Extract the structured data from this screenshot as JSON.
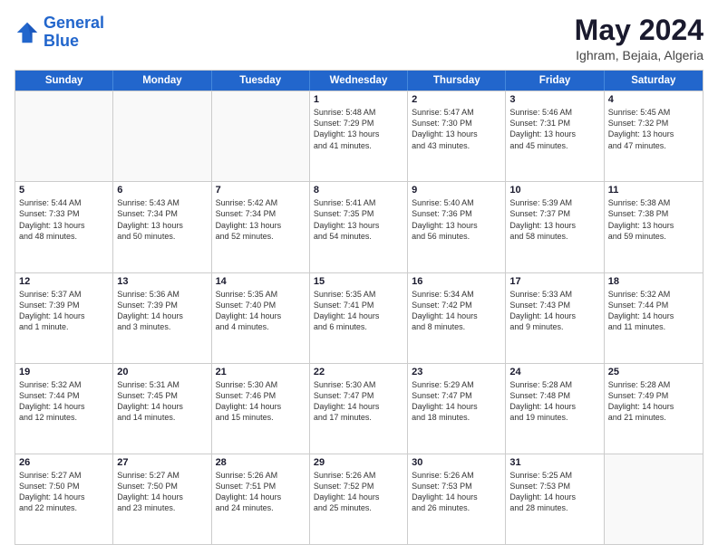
{
  "logo": {
    "line1": "General",
    "line2": "Blue"
  },
  "title": "May 2024",
  "location": "Ighram, Bejaia, Algeria",
  "days_of_week": [
    "Sunday",
    "Monday",
    "Tuesday",
    "Wednesday",
    "Thursday",
    "Friday",
    "Saturday"
  ],
  "weeks": [
    [
      {
        "day": "",
        "info": ""
      },
      {
        "day": "",
        "info": ""
      },
      {
        "day": "",
        "info": ""
      },
      {
        "day": "1",
        "info": "Sunrise: 5:48 AM\nSunset: 7:29 PM\nDaylight: 13 hours\nand 41 minutes."
      },
      {
        "day": "2",
        "info": "Sunrise: 5:47 AM\nSunset: 7:30 PM\nDaylight: 13 hours\nand 43 minutes."
      },
      {
        "day": "3",
        "info": "Sunrise: 5:46 AM\nSunset: 7:31 PM\nDaylight: 13 hours\nand 45 minutes."
      },
      {
        "day": "4",
        "info": "Sunrise: 5:45 AM\nSunset: 7:32 PM\nDaylight: 13 hours\nand 47 minutes."
      }
    ],
    [
      {
        "day": "5",
        "info": "Sunrise: 5:44 AM\nSunset: 7:33 PM\nDaylight: 13 hours\nand 48 minutes."
      },
      {
        "day": "6",
        "info": "Sunrise: 5:43 AM\nSunset: 7:34 PM\nDaylight: 13 hours\nand 50 minutes."
      },
      {
        "day": "7",
        "info": "Sunrise: 5:42 AM\nSunset: 7:34 PM\nDaylight: 13 hours\nand 52 minutes."
      },
      {
        "day": "8",
        "info": "Sunrise: 5:41 AM\nSunset: 7:35 PM\nDaylight: 13 hours\nand 54 minutes."
      },
      {
        "day": "9",
        "info": "Sunrise: 5:40 AM\nSunset: 7:36 PM\nDaylight: 13 hours\nand 56 minutes."
      },
      {
        "day": "10",
        "info": "Sunrise: 5:39 AM\nSunset: 7:37 PM\nDaylight: 13 hours\nand 58 minutes."
      },
      {
        "day": "11",
        "info": "Sunrise: 5:38 AM\nSunset: 7:38 PM\nDaylight: 13 hours\nand 59 minutes."
      }
    ],
    [
      {
        "day": "12",
        "info": "Sunrise: 5:37 AM\nSunset: 7:39 PM\nDaylight: 14 hours\nand 1 minute."
      },
      {
        "day": "13",
        "info": "Sunrise: 5:36 AM\nSunset: 7:39 PM\nDaylight: 14 hours\nand 3 minutes."
      },
      {
        "day": "14",
        "info": "Sunrise: 5:35 AM\nSunset: 7:40 PM\nDaylight: 14 hours\nand 4 minutes."
      },
      {
        "day": "15",
        "info": "Sunrise: 5:35 AM\nSunset: 7:41 PM\nDaylight: 14 hours\nand 6 minutes."
      },
      {
        "day": "16",
        "info": "Sunrise: 5:34 AM\nSunset: 7:42 PM\nDaylight: 14 hours\nand 8 minutes."
      },
      {
        "day": "17",
        "info": "Sunrise: 5:33 AM\nSunset: 7:43 PM\nDaylight: 14 hours\nand 9 minutes."
      },
      {
        "day": "18",
        "info": "Sunrise: 5:32 AM\nSunset: 7:44 PM\nDaylight: 14 hours\nand 11 minutes."
      }
    ],
    [
      {
        "day": "19",
        "info": "Sunrise: 5:32 AM\nSunset: 7:44 PM\nDaylight: 14 hours\nand 12 minutes."
      },
      {
        "day": "20",
        "info": "Sunrise: 5:31 AM\nSunset: 7:45 PM\nDaylight: 14 hours\nand 14 minutes."
      },
      {
        "day": "21",
        "info": "Sunrise: 5:30 AM\nSunset: 7:46 PM\nDaylight: 14 hours\nand 15 minutes."
      },
      {
        "day": "22",
        "info": "Sunrise: 5:30 AM\nSunset: 7:47 PM\nDaylight: 14 hours\nand 17 minutes."
      },
      {
        "day": "23",
        "info": "Sunrise: 5:29 AM\nSunset: 7:47 PM\nDaylight: 14 hours\nand 18 minutes."
      },
      {
        "day": "24",
        "info": "Sunrise: 5:28 AM\nSunset: 7:48 PM\nDaylight: 14 hours\nand 19 minutes."
      },
      {
        "day": "25",
        "info": "Sunrise: 5:28 AM\nSunset: 7:49 PM\nDaylight: 14 hours\nand 21 minutes."
      }
    ],
    [
      {
        "day": "26",
        "info": "Sunrise: 5:27 AM\nSunset: 7:50 PM\nDaylight: 14 hours\nand 22 minutes."
      },
      {
        "day": "27",
        "info": "Sunrise: 5:27 AM\nSunset: 7:50 PM\nDaylight: 14 hours\nand 23 minutes."
      },
      {
        "day": "28",
        "info": "Sunrise: 5:26 AM\nSunset: 7:51 PM\nDaylight: 14 hours\nand 24 minutes."
      },
      {
        "day": "29",
        "info": "Sunrise: 5:26 AM\nSunset: 7:52 PM\nDaylight: 14 hours\nand 25 minutes."
      },
      {
        "day": "30",
        "info": "Sunrise: 5:26 AM\nSunset: 7:53 PM\nDaylight: 14 hours\nand 26 minutes."
      },
      {
        "day": "31",
        "info": "Sunrise: 5:25 AM\nSunset: 7:53 PM\nDaylight: 14 hours\nand 28 minutes."
      },
      {
        "day": "",
        "info": ""
      }
    ]
  ]
}
